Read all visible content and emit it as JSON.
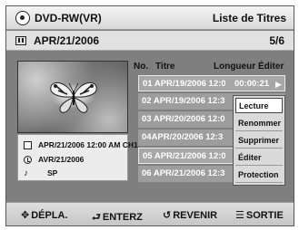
{
  "header": {
    "disc_type": "DVD-RW(VR)",
    "title": "Liste de Titres"
  },
  "subheader": {
    "date": "APR/21/2006",
    "page": "5/6"
  },
  "preview_info": {
    "timestamp": "APR/21/2006 12:00 AM CH1",
    "record_date": "AVR/21/2006",
    "quality": "SP"
  },
  "columns": {
    "no": "No.",
    "title": "Titre",
    "length": "Longueur",
    "edit": "Éditer"
  },
  "titles": [
    {
      "text": "01 APR/19/2006  12:0",
      "length": "00:00:21",
      "play_glyph": "▶"
    },
    {
      "text": "02 APR/19/2006  12:3"
    },
    {
      "text": "03 APR/20/2006  12:0"
    },
    {
      "text": "04APR/20/2006  12:3"
    },
    {
      "text": "05 APR/21/2006  12:0"
    },
    {
      "text": "06 APR/21/2006  12:3"
    }
  ],
  "context_menu": {
    "items": [
      "Lecture",
      "Renommer",
      "Supprimer",
      "Éditer",
      "Protection"
    ],
    "selected_index": 0
  },
  "footer": {
    "move": "DÉPLA.",
    "enter": "ENTERZ",
    "back": "REVENIR",
    "exit": "SORTIE"
  },
  "icons": {
    "disc": "disc-icon",
    "film": "film-icon",
    "document": "document-icon",
    "clock": "clock-icon",
    "speaker": "speaker-icon",
    "move": "four-way-arrow-icon",
    "enter": "enter-icon",
    "back": "return-arrow-icon",
    "exit": "menu-icon"
  }
}
